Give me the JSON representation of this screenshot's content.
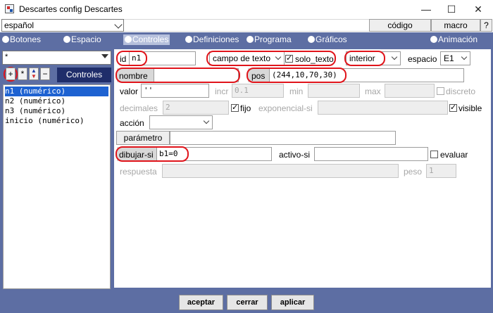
{
  "window": {
    "title": "Descartes config Descartes",
    "minimize": "—",
    "maximize": "☐",
    "close": "✕"
  },
  "topbar": {
    "language": "español",
    "codigo_label": "código",
    "macro_label": "macro",
    "help_label": "?"
  },
  "tabs": [
    {
      "label": "Botones",
      "selected": false
    },
    {
      "label": "Espacio",
      "selected": false
    },
    {
      "label": "Controles",
      "selected": true
    },
    {
      "label": "Definiciones",
      "selected": false
    },
    {
      "label": "Programa",
      "selected": false
    },
    {
      "label": "Gráficos",
      "selected": false
    },
    {
      "label": "Animación",
      "selected": false
    }
  ],
  "left": {
    "filter_value": "*",
    "add_label": "+",
    "star_label": "*",
    "minus_label": "−",
    "section_label": "Controles",
    "items": [
      {
        "label": "n1 (numérico)",
        "selected": true
      },
      {
        "label": "n2 (numérico)",
        "selected": false
      },
      {
        "label": "n3 (numérico)",
        "selected": false
      },
      {
        "label": "inicio (numérico)",
        "selected": false
      }
    ]
  },
  "form": {
    "id_label": "id",
    "id_value": "n1",
    "type_value": "campo de texto",
    "solo_texto_label": "solo_texto",
    "solo_texto_checked": true,
    "region_value": "interior",
    "espacio_label": "espacio",
    "espacio_value": "E1",
    "nombre_label": "nombre",
    "nombre_value": "",
    "pos_label": "pos",
    "pos_value": "(244,10,70,30)",
    "valor_label": "valor",
    "valor_value": "''",
    "incr_label": "incr",
    "incr_value": "0.1",
    "min_label": "min",
    "min_value": "",
    "max_label": "max",
    "max_value": "",
    "discreto_label": "discreto",
    "decimales_label": "decimales",
    "decimales_value": "2",
    "fijo_label": "fijo",
    "exponencial_label": "exponencial-si",
    "exponencial_value": "",
    "visible_label": "visible",
    "accion_label": "acción",
    "accion_value": "",
    "parametro_label": "parámetro",
    "parametro_value": "",
    "dibujar_label": "dibujar-si",
    "dibujar_value": "b1=0",
    "activo_label": "activo-si",
    "activo_value": "",
    "evaluar_label": "evaluar",
    "respuesta_label": "respuesta",
    "respuesta_value": "",
    "peso_label": "peso",
    "peso_value": "1"
  },
  "footer": {
    "accept_label": "aceptar",
    "close_label": "cerrar",
    "apply_label": "aplicar"
  },
  "colors": {
    "panel_blue": "#5d6ea3",
    "section_navy": "#1f2d6a",
    "highlight_red": "#e0141b",
    "selection_blue": "#1e62d1"
  }
}
